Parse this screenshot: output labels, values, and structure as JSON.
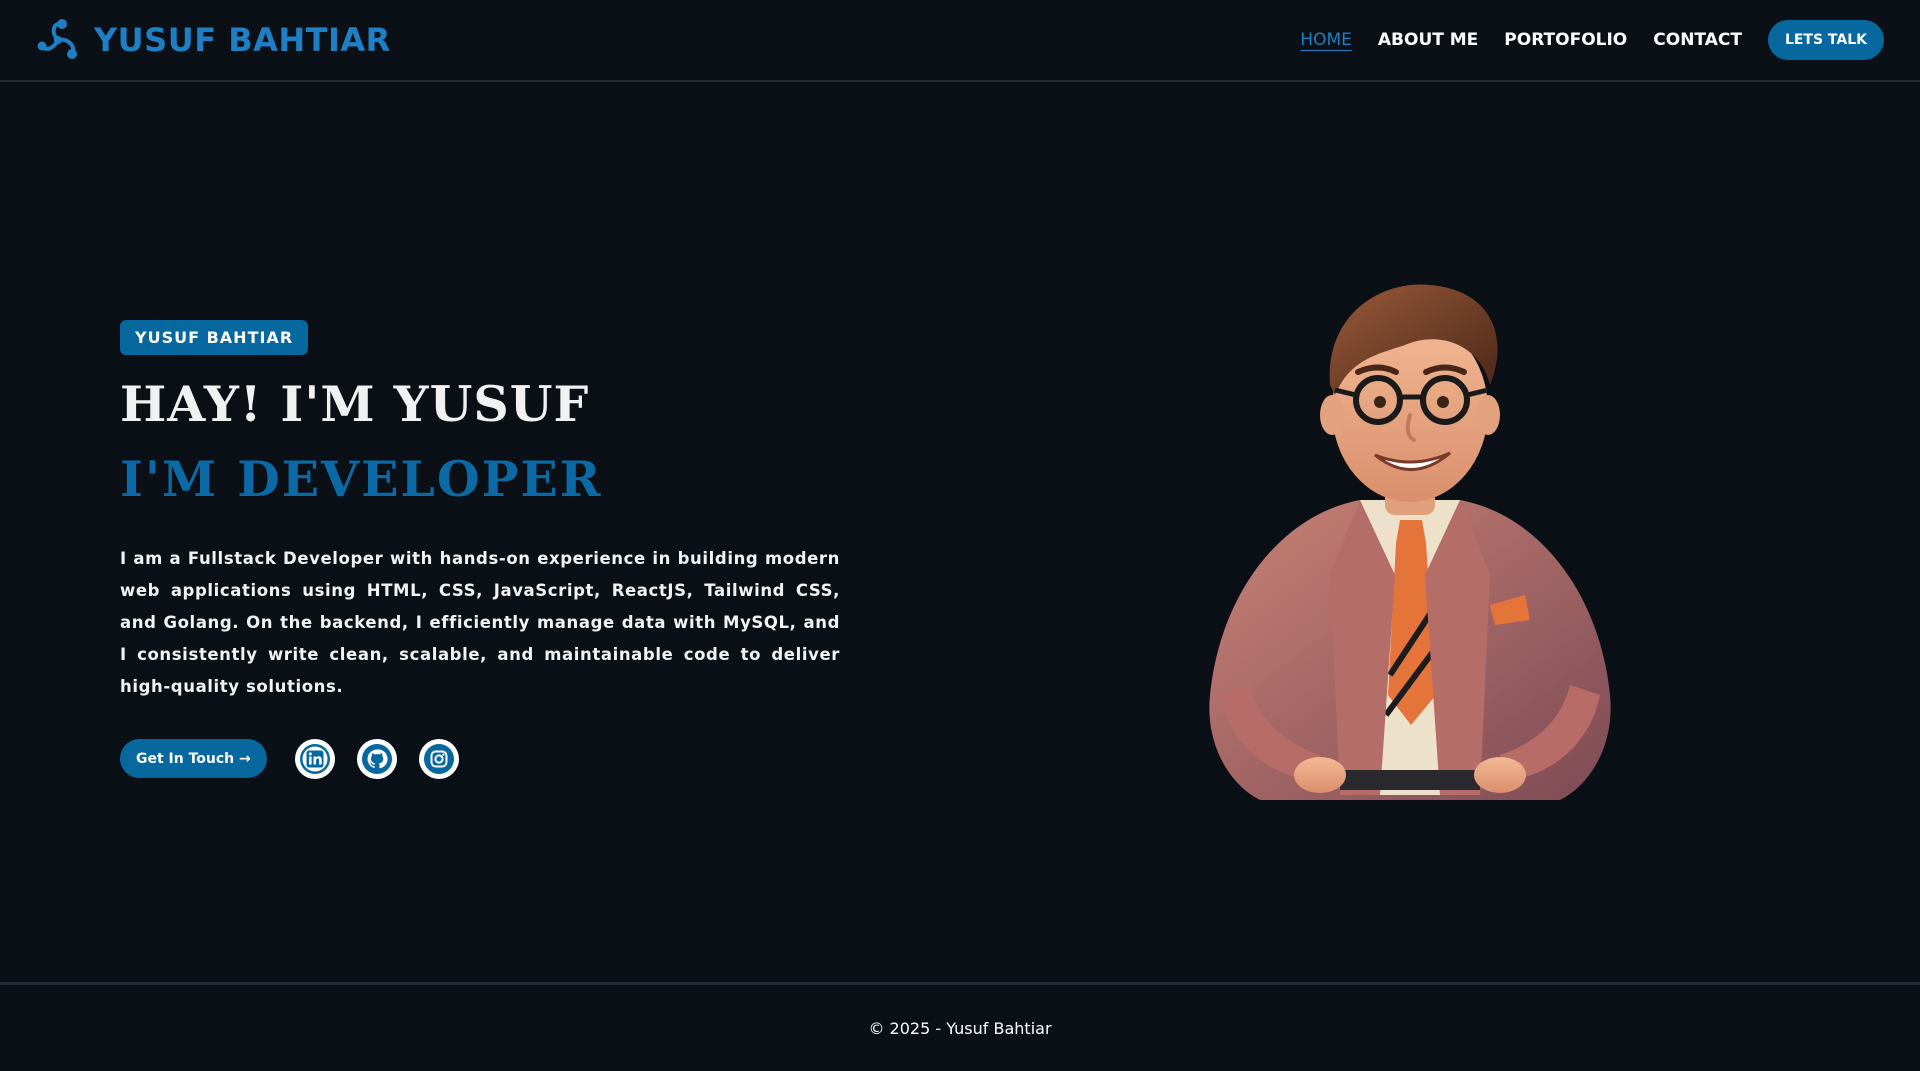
{
  "header": {
    "brand": {
      "name": "YUSUF BAHTIAR",
      "logo_icon": "molecule-logo-icon"
    },
    "nav": {
      "items": [
        {
          "label": "HOME",
          "active": true
        },
        {
          "label": "ABOUT ME",
          "active": false
        },
        {
          "label": "PORTOFOLIO",
          "active": false
        },
        {
          "label": "CONTACT",
          "active": false
        }
      ],
      "cta_label": "LETS TALK"
    }
  },
  "hero": {
    "badge": "YUSUF BAHTIAR",
    "title": "HAY! I'M YUSUF",
    "subtitle": "I'M DEVELOPER",
    "description": "I am a Fullstack Developer with hands-on experience in building modern web applications using HTML, CSS, JavaScript, ReactJS, Tailwind CSS, and Golang. On the backend, I efficiently manage data with MySQL, and I consistently write clean, scalable, and maintainable code to deliver high-quality solutions.",
    "cta_label": "Get In Touch →",
    "socials": [
      {
        "name": "linkedin",
        "icon": "linkedin-icon"
      },
      {
        "name": "github",
        "icon": "github-icon"
      },
      {
        "name": "instagram",
        "icon": "instagram-icon"
      }
    ],
    "illustration": "cartoon-developer-avatar"
  },
  "footer": {
    "copyright": "© 2025 - Yusuf Bahtiar"
  },
  "colors": {
    "background": "#0b1016",
    "accent": "#07679f",
    "accent_text": "#1f7fc4",
    "divider": "#222a33",
    "text": "#ffffff"
  }
}
